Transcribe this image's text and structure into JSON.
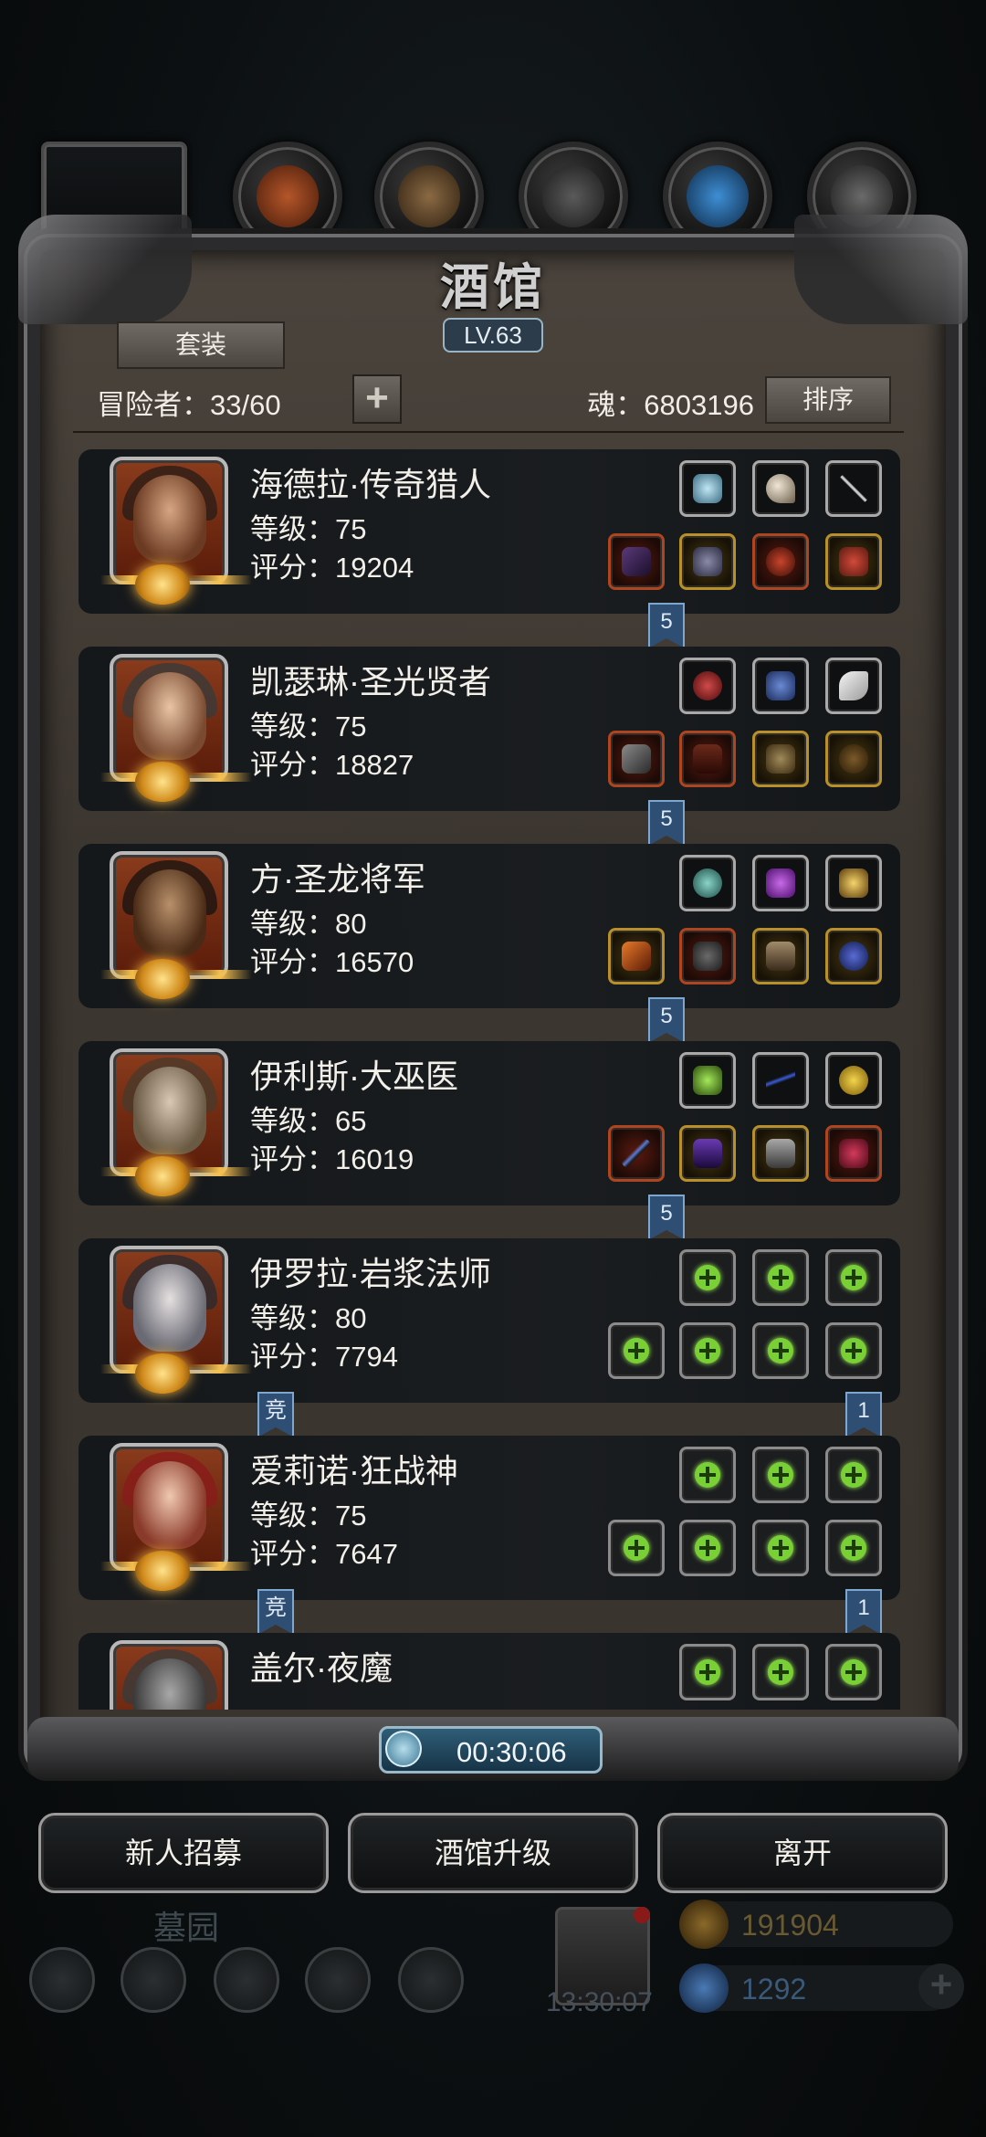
{
  "window": {
    "title": "酒馆",
    "level": "LV.63"
  },
  "toolbar": {
    "suit_label": "套装",
    "adventurers_label": "冒险者：33/60",
    "add_label": "+",
    "soul_label": "魂：6803196",
    "sort_label": "排序"
  },
  "colors": {
    "accent_green": "#78d034",
    "tag_blue": "#2e4e74",
    "gold": "#d08a1a"
  },
  "heroes": [
    {
      "name": "海德拉·传奇猎人",
      "level": "等级：75",
      "score": "评分：19204",
      "top_slots": [
        "gem",
        "crescent",
        "needle"
      ],
      "bottom_slots": [
        "crossbow",
        "armor",
        "shield",
        "ring",
        "amulet"
      ],
      "tag_right": "5"
    },
    {
      "name": "凯瑟琳·圣光贤者",
      "level": "等级：75",
      "score": "评分：18827",
      "top_slots": [
        "potion",
        "lantern",
        "feather"
      ],
      "bottom_slots": [
        "hammer",
        "robe",
        "mask",
        "bag"
      ],
      "tag_right": "5"
    },
    {
      "name": "方·圣龙将军",
      "level": "等级：80",
      "score": "评分：16570",
      "top_slots": [
        "orb",
        "crystal",
        "lamp"
      ],
      "bottom_slots": [
        "blade",
        "plate",
        "gauntlet",
        "pendant"
      ],
      "tag_right": "5"
    },
    {
      "name": "伊利斯·大巫医",
      "level": "等级：65",
      "score": "评分：16019",
      "top_slots": [
        "totem",
        "rope",
        "apple"
      ],
      "bottom_slots": [
        "staff",
        "cloak",
        "glove",
        "flask"
      ],
      "tag_right": "5"
    },
    {
      "name": "伊罗拉·岩浆法师",
      "level": "等级：80",
      "score": "评分：7794",
      "top_slots": [
        "add",
        "add",
        "add"
      ],
      "bottom_slots": [
        "add",
        "add",
        "add",
        "add"
      ],
      "tag_left": "竞",
      "tag_right": "1"
    },
    {
      "name": "爱莉诺·狂战神",
      "level": "等级：75",
      "score": "评分：7647",
      "top_slots": [
        "add",
        "add",
        "add"
      ],
      "bottom_slots": [
        "add",
        "add",
        "add",
        "add"
      ],
      "tag_left": "竞",
      "tag_right": "1"
    },
    {
      "name": "盖尔·夜魔",
      "level": "",
      "score": "",
      "top_slots": [
        "add",
        "add",
        "add"
      ],
      "bottom_slots": []
    }
  ],
  "timer": {
    "value": "00:30:06",
    "icon": "clock-icon"
  },
  "buttons": {
    "recruit": "新人招募",
    "upgrade": "酒馆升级",
    "leave": "离开"
  },
  "background_hud": {
    "location": "墓园",
    "chest_timer": "13:30:07",
    "gold": "191904",
    "gems": "1292"
  }
}
